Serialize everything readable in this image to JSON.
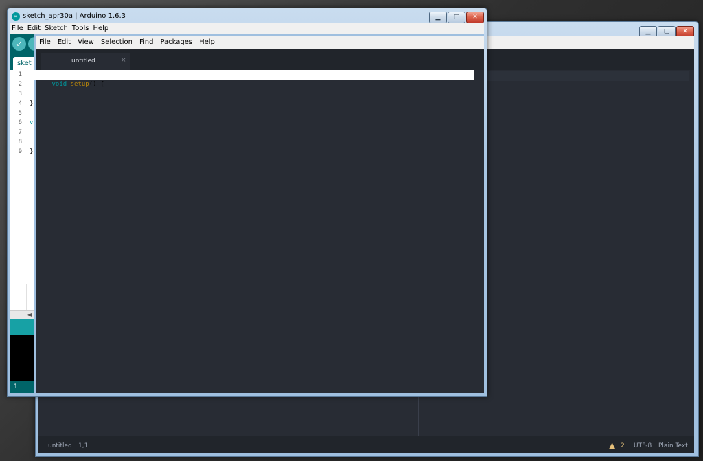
{
  "background_color": "#2a2a2a",
  "atom_window": {
    "menu": [
      "File",
      "Edit",
      "View",
      "Selection",
      "Find",
      "Packages",
      "Help"
    ],
    "tab": {
      "label": "untitled",
      "close_glyph": "×"
    },
    "status": {
      "file": "untitled",
      "cursor": "1,1",
      "warnings": "2",
      "encoding": "UTF-8",
      "grammar": "Plain Text"
    },
    "window_buttons": {
      "minimize": "▁",
      "maximize": "▢",
      "close": "✕"
    }
  },
  "arduino_window": {
    "title": "sketch_apr30a | Arduino 1.6.3",
    "menu": [
      "File",
      "Edit",
      "Sketch",
      "Tools",
      "Help"
    ],
    "tab_label": "sket",
    "gutter_lines": [
      "1",
      "2",
      "3",
      "4",
      "5",
      "6",
      "7",
      "8",
      "9"
    ],
    "code": {
      "line1_keyword": "void",
      "line1_function": "setup",
      "line1_rest": "() {",
      "line4": "}",
      "line6": "v",
      "line9": "}"
    },
    "status_line": "1",
    "window_buttons": {
      "minimize": "▁",
      "maximize": "▢",
      "close": "✕"
    },
    "colors": {
      "teal": "#00979c",
      "toolbar_teal": "#17a1a5"
    }
  }
}
